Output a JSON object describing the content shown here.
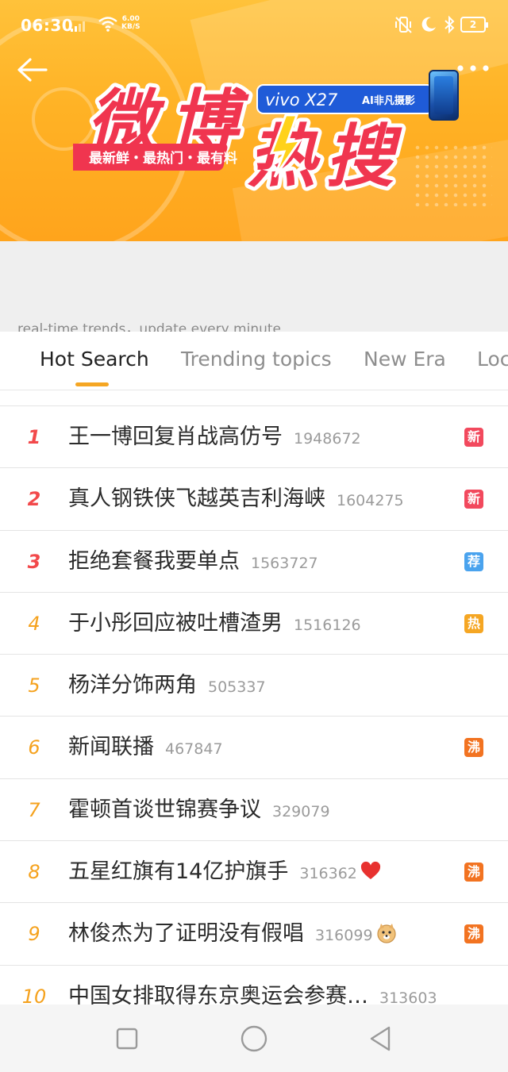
{
  "status_bar": {
    "time": "06:30",
    "net_speed": "6.00",
    "net_unit": "KB/S",
    "battery": "2"
  },
  "banner": {
    "logo_text": "微博热搜",
    "logo_char_1": "微",
    "logo_char_2": "博",
    "logo_char_3": "热",
    "logo_char_4": "搜",
    "tagline": "最新鲜・最热门・最有料",
    "sponsor_text": "vivo X27",
    "sponsor_sub": "AI非凡摄影",
    "colors": {
      "bg": "#ffb225",
      "logo_red": "#f0354f",
      "sponsor_blue": "#1f5bd8"
    }
  },
  "subtitle": "real-time trends，update every minute",
  "tabs": [
    {
      "label": "Hot Search",
      "active": true
    },
    {
      "label": "Trending topics",
      "active": false
    },
    {
      "label": "New Era",
      "active": false
    },
    {
      "label": "Loc",
      "active": false
    }
  ],
  "hot_list": [
    {
      "rank": "1",
      "title": "王一博回复肖战高仿号",
      "count": "1948672",
      "badge": "新",
      "badge_color": "#f2495d",
      "emoji": ""
    },
    {
      "rank": "2",
      "title": "真人钢铁侠飞越英吉利海峡",
      "count": "1604275",
      "badge": "新",
      "badge_color": "#f2495d",
      "emoji": ""
    },
    {
      "rank": "3",
      "title": "拒绝套餐我要单点",
      "count": "1563727",
      "badge": "荐",
      "badge_color": "#4aa3ee",
      "emoji": ""
    },
    {
      "rank": "4",
      "title": "于小彤回应被吐槽渣男",
      "count": "1516126",
      "badge": "热",
      "badge_color": "#f5a623",
      "emoji": ""
    },
    {
      "rank": "5",
      "title": "杨洋分饰两角",
      "count": "505337",
      "badge": "",
      "badge_color": "",
      "emoji": ""
    },
    {
      "rank": "6",
      "title": "新闻联播",
      "count": "467847",
      "badge": "沸",
      "badge_color": "#f27321",
      "emoji": ""
    },
    {
      "rank": "7",
      "title": "霍顿首谈世锦赛争议",
      "count": "329079",
      "badge": "",
      "badge_color": "",
      "emoji": ""
    },
    {
      "rank": "8",
      "title": "五星红旗有14亿护旗手",
      "count": "316362",
      "badge": "沸",
      "badge_color": "#f27321",
      "emoji": "heart"
    },
    {
      "rank": "9",
      "title": "林俊杰为了证明没有假唱",
      "count": "316099",
      "badge": "沸",
      "badge_color": "#f27321",
      "emoji": "doge"
    },
    {
      "rank": "10",
      "title": "中国女排取得东京奥运会参赛…",
      "count": "313603",
      "badge": "",
      "badge_color": "",
      "emoji": ""
    }
  ],
  "colors": {
    "accent": "#f5a623",
    "rank_top": "#f2494b",
    "rank_normal": "#f5a21e"
  }
}
